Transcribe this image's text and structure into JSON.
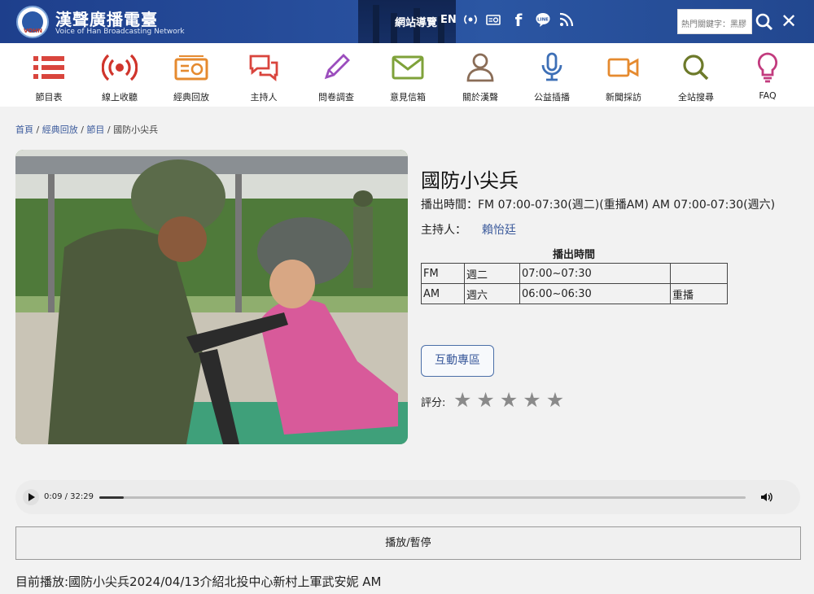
{
  "header": {
    "site_title": "漢聲廣播電臺",
    "site_subtitle": "Voice of Han Broadcasting Network",
    "logo_text": "VOHN",
    "sitemap_label": "網站導覽",
    "en_label": "EN",
    "search_placeholder": "熱門關鍵字：黑膠"
  },
  "nav": [
    {
      "label": "節目表",
      "icon": "list-icon"
    },
    {
      "label": "線上收聽",
      "icon": "live-broadcast-icon"
    },
    {
      "label": "經典回放",
      "icon": "radio-icon"
    },
    {
      "label": "主持人",
      "icon": "chat-bubbles-icon"
    },
    {
      "label": "問卷調查",
      "icon": "pencil-icon"
    },
    {
      "label": "意見信箱",
      "icon": "mail-icon"
    },
    {
      "label": "關於漢聲",
      "icon": "person-icon"
    },
    {
      "label": "公益插播",
      "icon": "microphone-icon"
    },
    {
      "label": "新聞採訪",
      "icon": "video-camera-icon"
    },
    {
      "label": "全站搜尋",
      "icon": "search-icon"
    },
    {
      "label": "FAQ",
      "icon": "lightbulb-icon"
    }
  ],
  "breadcrumb": [
    "首頁",
    "經典回放",
    "節目",
    "國防小尖兵"
  ],
  "program": {
    "title": "國防小尖兵",
    "airtime": "播出時間：FM 07:00-07:30(週二)(重播AM)  AM 07:00-07:30(週六)",
    "host_label": "主持人：",
    "host_name": "賴怡廷",
    "schedule_caption": "播出時間",
    "schedule": [
      [
        "FM",
        "週二",
        "07:00~07:30",
        ""
      ],
      [
        "AM",
        "週六",
        "06:00~06:30",
        "重播"
      ]
    ],
    "interact_label": "互動專區",
    "rating_label": "評分:",
    "rating_stars": 5,
    "rating_value": 0
  },
  "player": {
    "time": "0:09 / 32:29",
    "progress": 0.0046,
    "playpause_label": "播放/暫停",
    "now_playing": "目前播放:國防小尖兵2024/04/13介紹北投中心新村上軍武安妮 AM"
  }
}
